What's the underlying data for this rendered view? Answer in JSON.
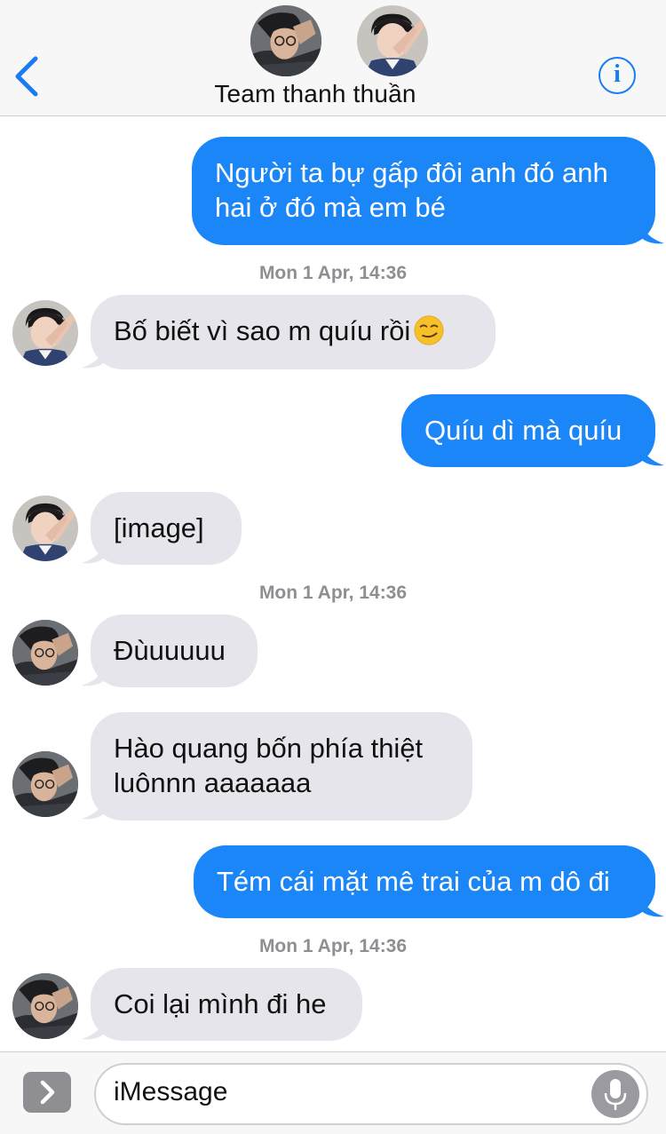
{
  "header": {
    "title": "Team thanh thuần",
    "back_icon": "chevron-left-icon",
    "info_icon": "info-icon",
    "info_glyph": "i"
  },
  "colors": {
    "accent": "#1a7cf4",
    "outgoing_bubble": "#1b86f7",
    "incoming_bubble": "#e6e5eb",
    "timestamp": "#8e8e93"
  },
  "messages": [
    {
      "direction": "outgoing",
      "lines": [
        "Người ta bự gấp đôi anh đó anh",
        "hai ở đó mà em bé"
      ]
    },
    {
      "type": "timestamp",
      "text": "Mon 1 Apr, 14:36"
    },
    {
      "direction": "incoming",
      "sender": "contact-b",
      "text": "Bố biết vì sao m quíu rồi",
      "emoji": "smirk-emoji"
    },
    {
      "direction": "outgoing",
      "text": "Quíu dì mà quíu"
    },
    {
      "direction": "incoming",
      "sender": "contact-b",
      "text": "[image]"
    },
    {
      "type": "timestamp",
      "text": "Mon 1 Apr, 14:36"
    },
    {
      "direction": "incoming",
      "sender": "contact-a",
      "text": "Đùuuuuu"
    },
    {
      "direction": "incoming",
      "sender": "contact-a",
      "lines": [
        "Hào quang bốn phía thiệt",
        "luônnn aaaaaaa"
      ]
    },
    {
      "direction": "outgoing",
      "text": "Tém cái mặt mê trai của m dô đi"
    },
    {
      "type": "timestamp",
      "text": "Mon 1 Apr, 14:36"
    },
    {
      "direction": "incoming",
      "sender": "contact-a",
      "text": "Coi lại mình đi he"
    }
  ],
  "input": {
    "placeholder": "iMessage",
    "apps_icon": "chevron-right-icon",
    "mic_icon": "microphone-icon"
  }
}
